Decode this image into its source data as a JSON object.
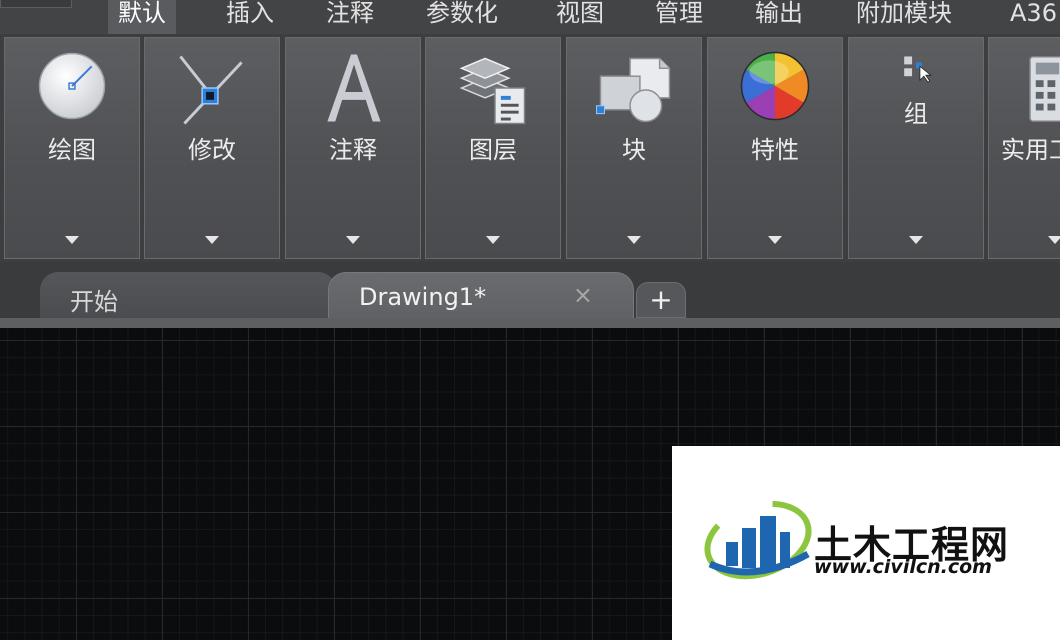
{
  "menu": {
    "tabs": [
      {
        "label": "默认",
        "active": true
      },
      {
        "label": "插入"
      },
      {
        "label": "注释"
      },
      {
        "label": "参数化"
      },
      {
        "label": "视图"
      },
      {
        "label": "管理"
      },
      {
        "label": "输出"
      },
      {
        "label": "附加模块"
      },
      {
        "label": "A36"
      }
    ]
  },
  "ribbon": {
    "panels": [
      {
        "label": "绘图",
        "icon": "draw-circle-icon"
      },
      {
        "label": "修改",
        "icon": "modify-lines-icon"
      },
      {
        "label": "注释",
        "icon": "text-a-icon"
      },
      {
        "label": "图层",
        "icon": "layers-icon"
      },
      {
        "label": "块",
        "icon": "block-icon"
      },
      {
        "label": "特性",
        "icon": "color-wheel-icon"
      },
      {
        "label": "组",
        "icon": "group-icon"
      },
      {
        "label": "实用工",
        "icon": "calculator-icon"
      }
    ]
  },
  "doc_tabs": {
    "start": "开始",
    "drawing": "Drawing1*",
    "close": "×",
    "add": "+"
  },
  "watermark": {
    "title": "土木工程网",
    "url": "www.civilcn.com"
  },
  "colors": {
    "ribbon_bg": "#3d3e40",
    "panel_bg": "#55565a",
    "canvas_bg": "#0b0c0e",
    "logo_blue": "#1f66b0",
    "logo_green": "#8cc63f"
  }
}
